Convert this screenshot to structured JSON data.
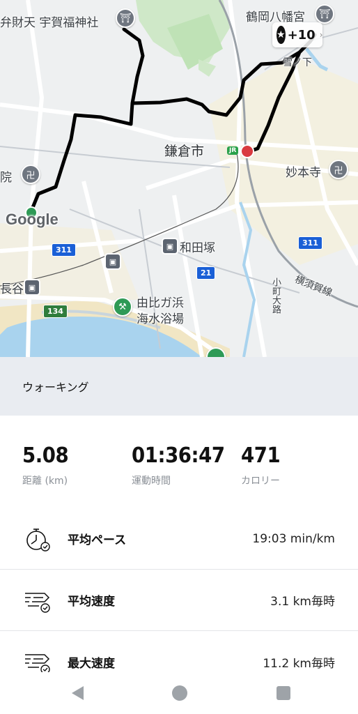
{
  "map": {
    "labels": {
      "benzaiten": "弁財天 宇賀福神社",
      "tsurugaoka": "鶴岡八幡宮",
      "kamakura": "鎌倉市",
      "myohonji": "妙本寺",
      "in": "院",
      "wadazuka": "和田塚",
      "hase": "長谷",
      "yuigahama": "由比ガ浜\n海水浴場",
      "yuigahama_line1": "由比ガ浜",
      "yuigahama_line2": "海水浴場",
      "yokosuka_line": "横須賀線",
      "komachi": "小町大路",
      "yuki": "雪ノ下",
      "road_311a": "311",
      "road_311b": "311",
      "road_21": "21",
      "road_134": "134",
      "jr": "JR"
    },
    "google_logo": "Google",
    "badge": {
      "icon": "star-icon",
      "text": "+10"
    }
  },
  "activity": {
    "title": "ウォーキング"
  },
  "stats": [
    {
      "value": "5.08",
      "label": "距離 (km)"
    },
    {
      "value": "01:36:47",
      "label": "運動時間"
    },
    {
      "value": "471",
      "label": "カロリー"
    }
  ],
  "metrics": [
    {
      "name": "平均ペース",
      "value": "19:03 min/km",
      "icon": "stopwatch-icon"
    },
    {
      "name": "平均速度",
      "value": "3.1 km毎時",
      "icon": "speed-icon"
    },
    {
      "name": "最大速度",
      "value": "11.2 km毎時",
      "icon": "speed-icon"
    }
  ],
  "nav": {
    "back": "back-icon",
    "home": "home-icon",
    "recents": "recents-icon"
  },
  "colors": {
    "route": "#000000",
    "sea": "#a9d3ee",
    "beach": "#f1e6c4",
    "park": "#cfe8c8",
    "accent_red": "#d93a3f",
    "start_green": "#2e9a56"
  }
}
